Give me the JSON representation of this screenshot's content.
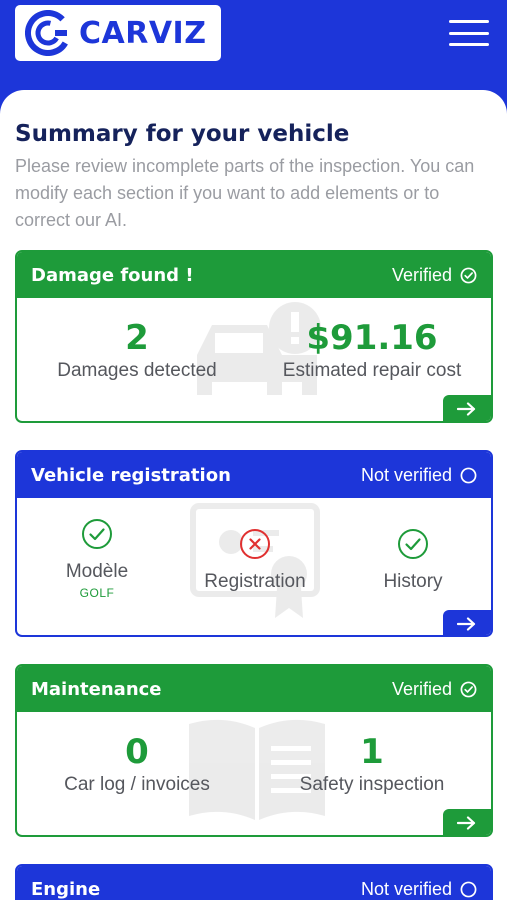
{
  "app": {
    "logo_text": "CARVIZ"
  },
  "header": {
    "title": "Summary for your vehicle",
    "subtitle": "Please review incomplete parts of the inspection. You can modify each section if you want to add elements or to correct our AI."
  },
  "colors": {
    "brand_blue": "#1d36d9",
    "verified_green": "#1e9b3a",
    "error_red": "#e03030"
  },
  "cards": [
    {
      "title": "Damage found !",
      "status": "Verified",
      "status_icon": "check-circle-icon",
      "stats": [
        {
          "value": "2",
          "label": "Damages detected"
        },
        {
          "value": "$91.16",
          "label": "Estimated repair cost"
        }
      ]
    },
    {
      "title": "Vehicle registration",
      "status": "Not verified",
      "status_icon": "empty-circle-icon",
      "items": [
        {
          "label": "Modèle",
          "sub": "GOLF",
          "state": "ok"
        },
        {
          "label": "Registration",
          "sub": "",
          "state": "error"
        },
        {
          "label": "History",
          "sub": "",
          "state": "ok"
        }
      ]
    },
    {
      "title": "Maintenance",
      "status": "Verified",
      "status_icon": "check-circle-icon",
      "stats": [
        {
          "value": "0",
          "label": "Car log / invoices"
        },
        {
          "value": "1",
          "label": "Safety inspection"
        }
      ]
    },
    {
      "title": "Engine",
      "status": "Not verified",
      "status_icon": "empty-circle-icon"
    }
  ]
}
